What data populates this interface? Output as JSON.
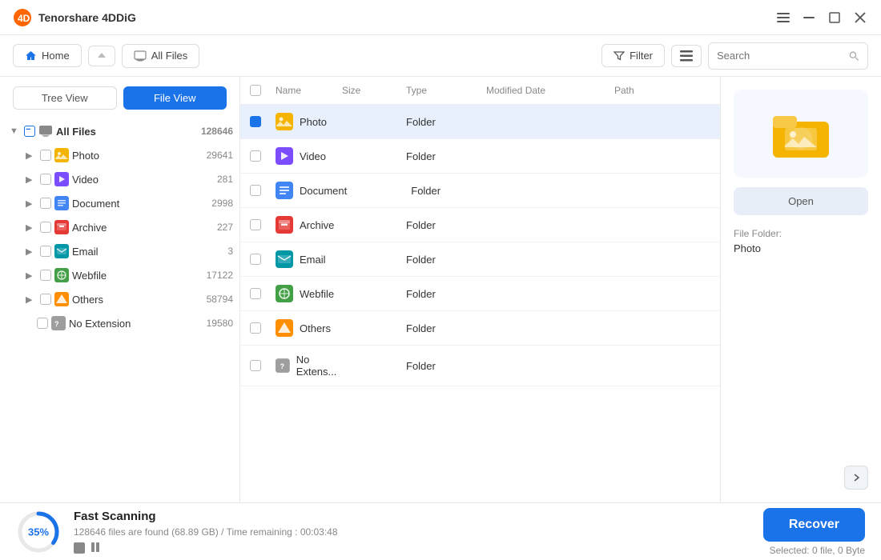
{
  "app": {
    "title": "Tenorshare 4DDiG",
    "logo_color": "#ff6600"
  },
  "titlebar": {
    "title": "Tenorshare 4DDiG",
    "controls": [
      "minimize",
      "restore",
      "close"
    ]
  },
  "toolbar": {
    "home_label": "Home",
    "breadcrumb_icon": "computer-icon",
    "breadcrumb_label": "All Files",
    "filter_label": "Filter",
    "search_placeholder": "Search"
  },
  "sidebar": {
    "view_tree": "Tree View",
    "view_file": "File View",
    "active_view": "File View",
    "items": [
      {
        "id": "all-files",
        "label": "All Files",
        "count": "128646",
        "level": 0,
        "expanded": true,
        "selected": false
      },
      {
        "id": "photo",
        "label": "Photo",
        "count": "29641",
        "level": 1,
        "selected": false
      },
      {
        "id": "video",
        "label": "Video",
        "count": "281",
        "level": 1,
        "selected": false
      },
      {
        "id": "document",
        "label": "Document",
        "count": "2998",
        "level": 1,
        "selected": false
      },
      {
        "id": "archive",
        "label": "Archive",
        "count": "227",
        "level": 1,
        "selected": false
      },
      {
        "id": "email",
        "label": "Email",
        "count": "3",
        "level": 1,
        "selected": false
      },
      {
        "id": "webfile",
        "label": "Webfile",
        "count": "17122",
        "level": 1,
        "selected": false
      },
      {
        "id": "others",
        "label": "Others",
        "count": "58794",
        "level": 1,
        "selected": false
      },
      {
        "id": "no-extension",
        "label": "No Extension",
        "count": "19580",
        "level": 1,
        "selected": false
      }
    ]
  },
  "file_list": {
    "columns": [
      "Name",
      "Size",
      "Type",
      "Modified Date",
      "Path"
    ],
    "rows": [
      {
        "id": "photo",
        "name": "Photo",
        "size": "",
        "type": "Folder",
        "modified": "",
        "path": "",
        "selected": true
      },
      {
        "id": "video",
        "name": "Video",
        "size": "",
        "type": "Folder",
        "modified": "",
        "path": "",
        "selected": false
      },
      {
        "id": "document",
        "name": "Document",
        "size": "",
        "type": "Folder",
        "modified": "",
        "path": "",
        "selected": false
      },
      {
        "id": "archive",
        "name": "Archive",
        "size": "",
        "type": "Folder",
        "modified": "",
        "path": "",
        "selected": false
      },
      {
        "id": "email",
        "name": "Email",
        "size": "",
        "type": "Folder",
        "modified": "",
        "path": "",
        "selected": false
      },
      {
        "id": "webfile",
        "name": "Webfile",
        "size": "",
        "type": "Folder",
        "modified": "",
        "path": "",
        "selected": false
      },
      {
        "id": "others",
        "name": "Others",
        "size": "",
        "type": "Folder",
        "modified": "",
        "path": "",
        "selected": false
      },
      {
        "id": "no-extension",
        "name": "No Extens...",
        "size": "",
        "type": "Folder",
        "modified": "",
        "path": "",
        "selected": false
      }
    ]
  },
  "preview": {
    "open_label": "Open",
    "meta_label": "File Folder:",
    "meta_value": "Photo"
  },
  "bottom": {
    "progress_pct": 35,
    "scan_title": "Fast Scanning",
    "scan_details": "128646 files are found (68.89 GB)  /  Time remaining : 00:03:48",
    "recover_label": "Recover",
    "selected_info": "Selected: 0 file, 0 Byte"
  }
}
